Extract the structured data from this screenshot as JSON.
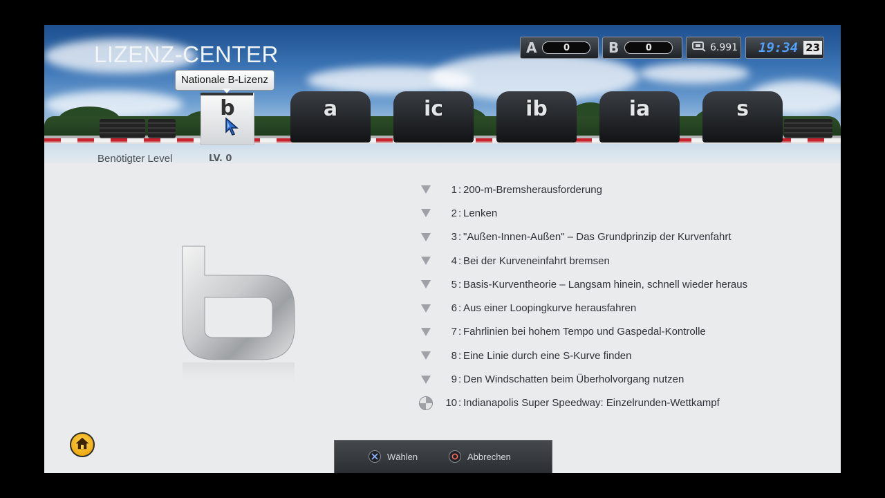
{
  "header": {
    "title": "LIZENZ-CENTER"
  },
  "hud": {
    "a_label": "A",
    "a_value": "0",
    "b_label": "B",
    "b_value": "0",
    "credits": "6.991",
    "time": "19:34",
    "day": "23"
  },
  "licenses": {
    "selected_tooltip": "Nationale B-Lizenz",
    "items": [
      {
        "label": "b",
        "selected": true
      },
      {
        "label": "a"
      },
      {
        "label": "ic"
      },
      {
        "label": "ib"
      },
      {
        "label": "ia"
      },
      {
        "label": "s"
      }
    ]
  },
  "requirement": {
    "label": "Benötigter Level",
    "value": "LV. 0"
  },
  "tasks": [
    {
      "num": "1",
      "sep": ":",
      "text": "200-m-Bremsherausforderung",
      "icon": "triangle"
    },
    {
      "num": "2",
      "sep": ":",
      "text": "Lenken",
      "icon": "triangle"
    },
    {
      "num": "3",
      "sep": ":",
      "text": "\"Außen-Innen-Außen\" – Das Grundprinzip der Kurvenfahrt",
      "icon": "triangle"
    },
    {
      "num": "4",
      "sep": ":",
      "text": "Bei der Kurveneinfahrt bremsen",
      "icon": "triangle"
    },
    {
      "num": "5",
      "sep": ":",
      "text": "Basis-Kurventheorie – Langsam hinein, schnell wieder heraus",
      "icon": "triangle"
    },
    {
      "num": "6",
      "sep": ":",
      "text": "Aus einer Loopingkurve herausfahren",
      "icon": "triangle"
    },
    {
      "num": "7",
      "sep": ":",
      "text": "Fahrlinien bei hohem Tempo und Gaspedal-Kontrolle",
      "icon": "triangle"
    },
    {
      "num": "8",
      "sep": ":",
      "text": "Eine Linie durch eine S-Kurve finden",
      "icon": "triangle"
    },
    {
      "num": "9",
      "sep": ":",
      "text": "Den Windschatten beim Überholvorgang nutzen",
      "icon": "triangle"
    },
    {
      "num": "10",
      "sep": ":",
      "text": "Indianapolis Super Speedway: Einzelrunden-Wettkampf",
      "icon": "checkered-flag"
    }
  ],
  "footer": {
    "select_label": "Wählen",
    "cancel_label": "Abbrechen"
  },
  "colors": {
    "time_blue": "#4fa0ff",
    "home_orange": "#f0a800"
  }
}
